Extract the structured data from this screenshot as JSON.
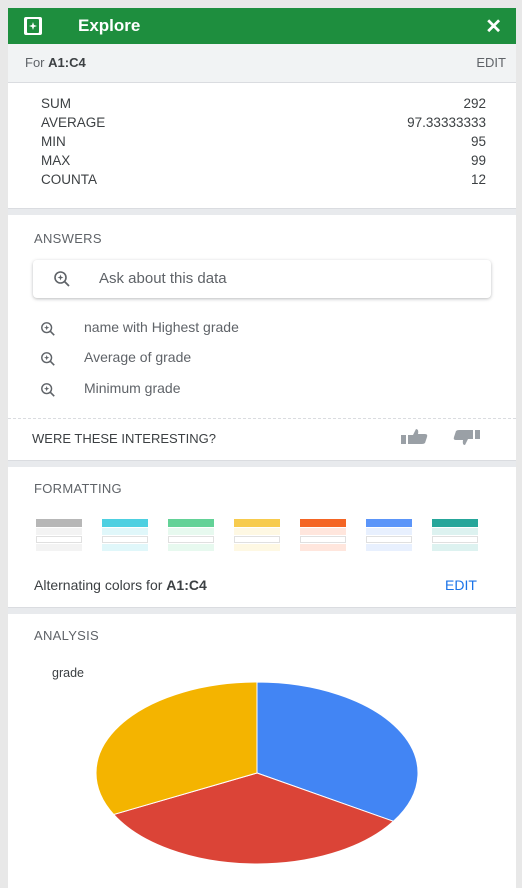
{
  "header": {
    "title": "Explore",
    "close_label": "✕",
    "icon": "explore-icon"
  },
  "range": {
    "prefix": "For ",
    "range": "A1:C4",
    "edit_label": "EDIT"
  },
  "stats": [
    {
      "key": "SUM",
      "value": "292"
    },
    {
      "key": "AVERAGE",
      "value": "97.33333333"
    },
    {
      "key": "MIN",
      "value": "95"
    },
    {
      "key": "MAX",
      "value": "99"
    },
    {
      "key": "COUNTA",
      "value": "12"
    }
  ],
  "answers": {
    "title": "ANSWERS",
    "placeholder": "Ask about this data",
    "suggestions": [
      "name with Highest grade",
      "Average of grade",
      "Minimum grade"
    ],
    "feedback_question": "WERE THESE INTERESTING?"
  },
  "formatting": {
    "title": "FORMATTING",
    "swatches": [
      {
        "header": "#b7b7b7",
        "row": "#f3f3f3"
      },
      {
        "header": "#4dd0e1",
        "row": "#e0f7fa"
      },
      {
        "header": "#63d297",
        "row": "#e7f9ef"
      },
      {
        "header": "#f7cb4d",
        "row": "#fef8e3"
      },
      {
        "header": "#f46524",
        "row": "#ffe6dd"
      },
      {
        "header": "#5b95f9",
        "row": "#e8f0fe"
      },
      {
        "header": "#26a69a",
        "row": "#ddf2f0"
      }
    ],
    "alt_prefix": "Alternating colors for ",
    "alt_range": "A1:C4",
    "edit_label": "EDIT"
  },
  "analysis": {
    "title": "ANALYSIS",
    "chart_data": {
      "type": "pie",
      "title": "grade",
      "values": [
        99,
        98,
        95
      ],
      "colors": [
        "#4285f4",
        "#db4437",
        "#f4b400"
      ]
    }
  },
  "colors": {
    "header_bg": "#1e8e3e",
    "accent": "#1a73e8"
  }
}
